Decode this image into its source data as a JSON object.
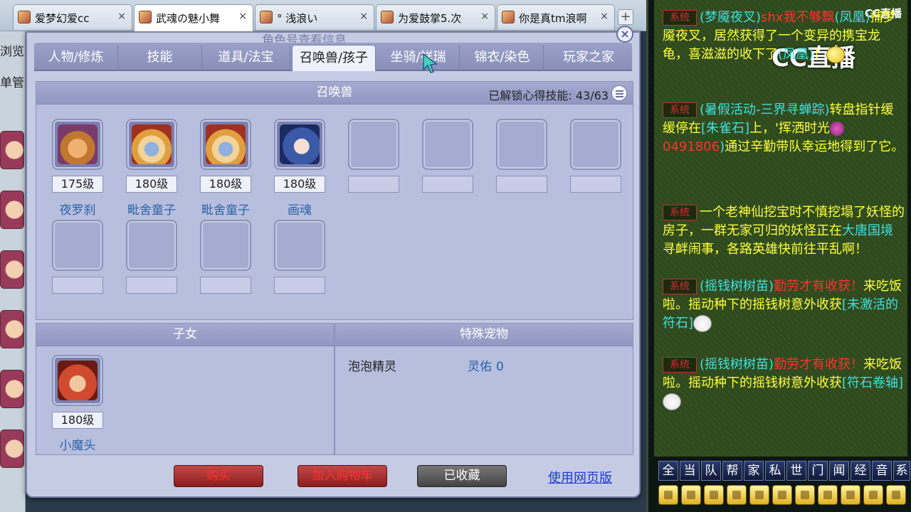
{
  "browser": {
    "tabs": [
      {
        "title": "爱梦幻爱cc",
        "active": false
      },
      {
        "title": "武魂の魅小舞",
        "active": true
      },
      {
        "title": "° 浅浪い",
        "active": false
      },
      {
        "title": "为爱鼓掌5.次",
        "active": false
      },
      {
        "title": "你是真tm浪啊",
        "active": false
      }
    ],
    "close_glyph": "×",
    "new_tab_glyph": "+"
  },
  "left_strip": {
    "browse_text": "浏览",
    "menu_text": "单管"
  },
  "dialog": {
    "title": "角色号查看信息",
    "close_glyph": "×",
    "tabs": [
      "人物/修炼",
      "技能",
      "道具/法宝",
      "召唤兽/孩子",
      "坐骑/祥瑞",
      "锦衣/染色",
      "玩家之家"
    ],
    "active_tab": "召唤兽/孩子",
    "summon": {
      "header": "召唤兽",
      "unlock_label": "已解锁心得技能:",
      "unlock_value": "43/63",
      "pets": [
        {
          "level": "175级",
          "name": "夜罗刹"
        },
        {
          "level": "180级",
          "name": "毗舍童子"
        },
        {
          "level": "180级",
          "name": "毗舍童子"
        },
        {
          "level": "180级",
          "name": "画魂"
        }
      ]
    },
    "children": {
      "header": "子女",
      "items": [
        {
          "level": "180级",
          "name": "小魔头"
        }
      ]
    },
    "special": {
      "header": "特殊宠物",
      "item_name": "泡泡精灵",
      "attr_label": "灵佑",
      "attr_value": "0"
    },
    "buttons": {
      "buy": "购买",
      "add_cart": "加入购物车",
      "collected": "已收藏",
      "web_link": "使用网页版"
    }
  },
  "chat": {
    "logo": "CC直播",
    "watermark": "CC直播",
    "system_tag": "系统",
    "messages": [
      {
        "parts": [
          {
            "t": "(梦魇夜叉)",
            "c": "cyan"
          },
          {
            "t": "shx我不够飘",
            "c": "red"
          },
          {
            "t": "(凤凰)",
            "c": "cyan"
          },
          {
            "t": "捕梦魇夜叉，居然获得了一个变异的携宝龙龟，喜滋滋的收下了",
            "c": "yellow"
          },
          {
            "t": "(凤凰)",
            "c": "cyan"
          },
          {
            "t": "！",
            "c": "yellow"
          }
        ]
      },
      {
        "parts": [
          {
            "t": "(暑假活动-三界寻蝉踪)",
            "c": "cyan"
          },
          {
            "t": "转盘指针缓缓停在",
            "c": "yellow"
          },
          {
            "t": "[朱雀石]",
            "c": "cyan"
          },
          {
            "t": "上，'挥洒时光",
            "c": "yellow"
          },
          {
            "t": "0491806",
            "c": "red"
          },
          {
            "t": ")",
            "c": "cyan"
          },
          {
            "t": "通过辛勤带队幸运地得到了它。",
            "c": "yellow"
          }
        ]
      },
      {
        "parts": [
          {
            "t": "一个老神仙挖宝时不慎挖塌了妖怪的房子，一群无家可归的妖怪正在",
            "c": "yellow"
          },
          {
            "t": "大唐国境",
            "c": "cyan"
          },
          {
            "t": "寻衅闹事，各路英雄快前往平乱啊！",
            "c": "yellow"
          }
        ]
      },
      {
        "parts": [
          {
            "t": "(摇钱树树苗)",
            "c": "cyan"
          },
          {
            "t": "勤劳才有收获！",
            "c": "red"
          },
          {
            "t": "来吃饭啦。摇动种下的摇钱树意外收获",
            "c": "yellow"
          },
          {
            "t": "[未激活的符石]",
            "c": "cyan"
          }
        ]
      },
      {
        "parts": [
          {
            "t": "(摇钱树树苗)",
            "c": "cyan"
          },
          {
            "t": "勤劳才有收获！",
            "c": "red"
          },
          {
            "t": "来吃饭啦。摇动种下的摇钱树意外收获",
            "c": "yellow"
          },
          {
            "t": "[符石卷轴]",
            "c": "cyan"
          }
        ]
      }
    ],
    "channels": [
      "全",
      "当",
      "队",
      "帮",
      "家",
      "私",
      "世",
      "门",
      "闻",
      "经",
      "音",
      "系"
    ]
  }
}
